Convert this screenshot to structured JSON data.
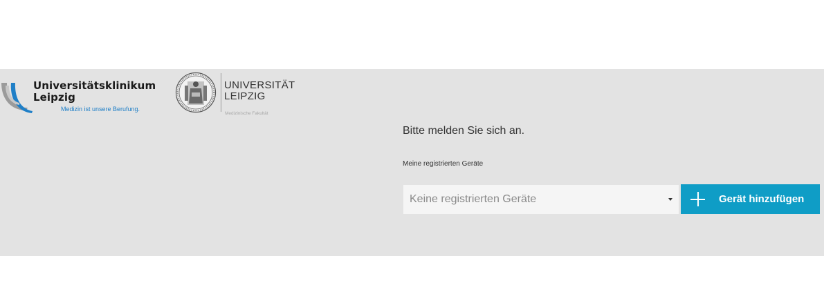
{
  "logos": {
    "ukl": {
      "line1": "Universitätsklinikum",
      "line2": "Leipzig",
      "tagline": "Medizin ist unsere Berufung.",
      "icon": "ukl-swoosh-logo",
      "accent": "#1f7fc7"
    },
    "uni": {
      "line1": "UNIVERSITÄT",
      "line2": "LEIPZIG",
      "faculty": "Medizinische Fakultät",
      "icon": "university-seal-logo"
    }
  },
  "login": {
    "prompt": "Bitte melden Sie sich an.",
    "devices_label": "Meine registrierten Geräte",
    "select": {
      "value": "Keine registrierten Geräte",
      "icon": "caret-down-icon"
    },
    "add_button": {
      "label": "Gerät hinzufügen",
      "icon": "plus-icon",
      "color": "#0f9dc6"
    }
  },
  "colors": {
    "band": "#e3e3e3",
    "background": "#ffffff"
  }
}
